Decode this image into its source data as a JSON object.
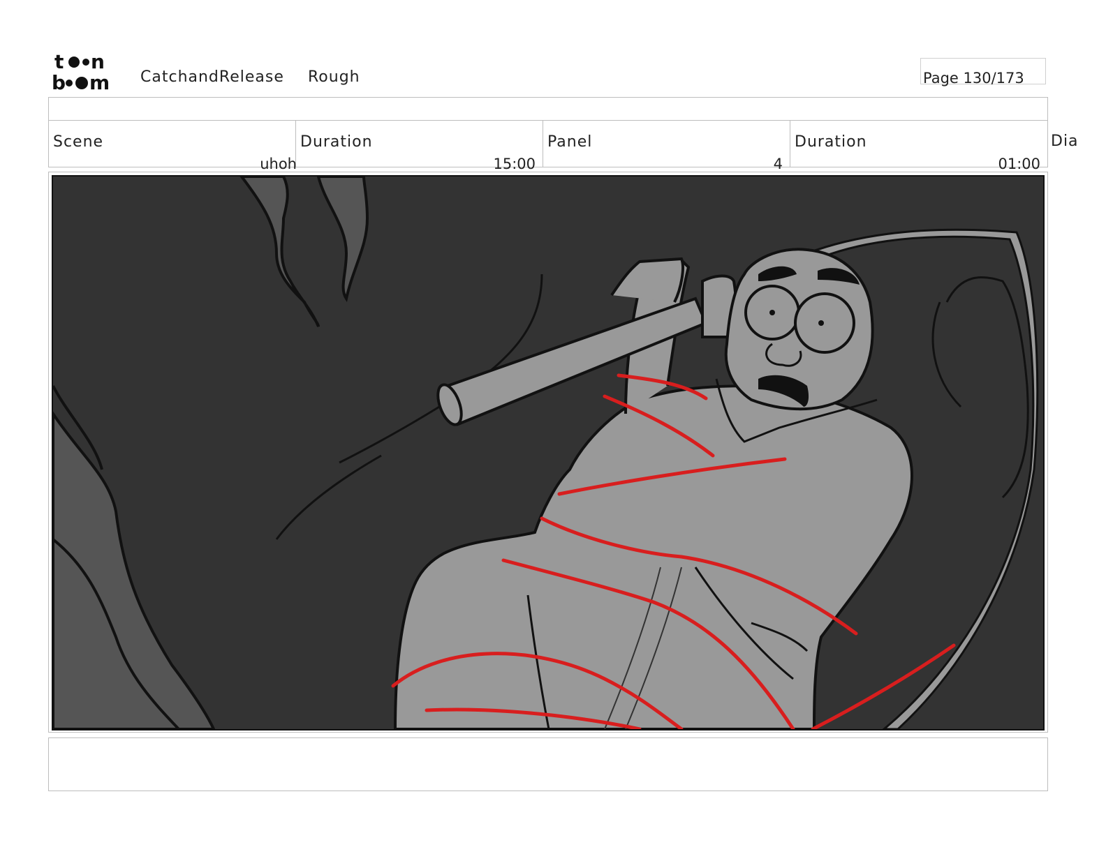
{
  "header": {
    "logo_text_top": "toon",
    "logo_text_bottom": "boom",
    "project": "CatchandRelease",
    "stage": "Rough",
    "page": "Page 130/173"
  },
  "info": {
    "scene_label": "Scene",
    "scene_value": "uhoh",
    "scene_duration_label": "Duration",
    "scene_duration_value": "15:00",
    "panel_label": "Panel",
    "panel_value": "4",
    "panel_duration_label": "Duration",
    "panel_duration_value": "01:00",
    "dialogue_label": "Dia"
  },
  "colors": {
    "background_dark": "#333333",
    "figure_gray": "#999999",
    "shadow_gray": "#555555",
    "rough_red": "#d81e1e",
    "line_black": "#111111"
  },
  "panel_art": {
    "description_icons": [
      "tree-shadow",
      "figure-with-pipe",
      "red-rough-lines"
    ]
  },
  "notes": {
    "text": ""
  }
}
